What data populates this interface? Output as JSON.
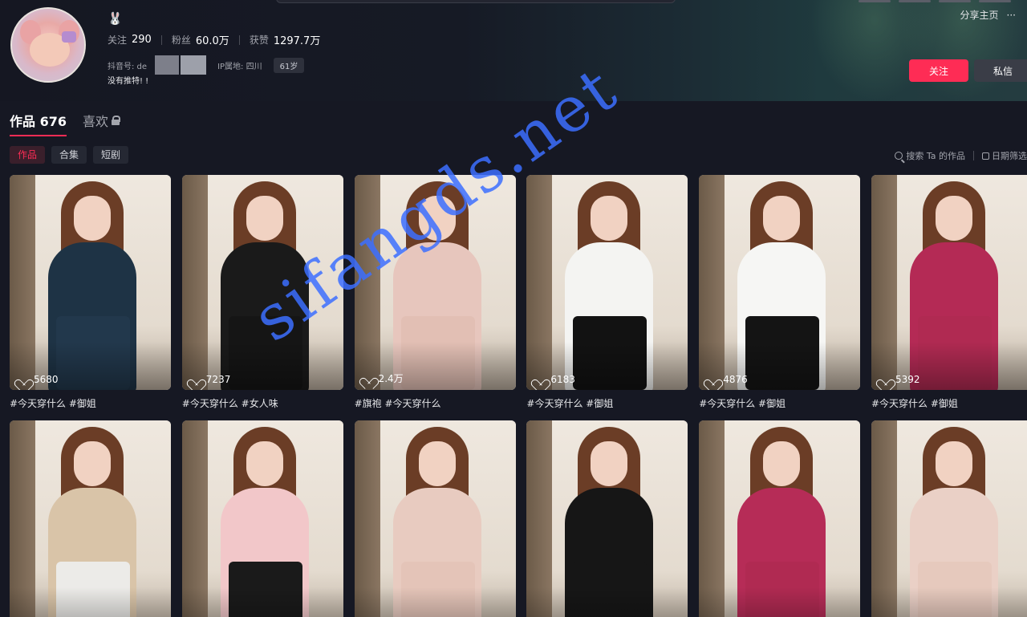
{
  "profile": {
    "name_icon": "rabbit-icon",
    "stats": [
      {
        "label": "关注",
        "value": "290"
      },
      {
        "label": "粉丝",
        "value": "60.0万"
      },
      {
        "label": "获赞",
        "value": "1297.7万"
      }
    ],
    "douyin_id_label": "抖音号: de",
    "ip_label": "IP属地: 四川",
    "age": "61岁",
    "bio": "没有推特! !",
    "share_label": "分享主页",
    "more_label": "···",
    "follow_label": "关注",
    "message_label": "私信"
  },
  "tabs": [
    {
      "label": "作品 676",
      "active": true
    },
    {
      "label": "喜欢",
      "active": false,
      "locked": true
    }
  ],
  "subtabs": [
    {
      "label": "作品",
      "active": true
    },
    {
      "label": "合集",
      "active": false
    },
    {
      "label": "短剧",
      "active": false
    }
  ],
  "tools": {
    "search_label": "搜索 Ta 的作品",
    "date_filter_label": "日期筛选"
  },
  "watermark": "sifangds.net",
  "colors": {
    "accent": "#fe2c55",
    "background": "#161823"
  },
  "videos": [
    {
      "likes": "5680",
      "caption": "#今天穿什么 #御姐",
      "outfit": "#1e3345",
      "skirt": "#22384c"
    },
    {
      "likes": "7237",
      "caption": "#今天穿什么 #女人味",
      "outfit": "#1a1a1a",
      "skirt": "#151515"
    },
    {
      "likes": "2.4万",
      "caption": "#旗袍 #今天穿什么",
      "outfit": "#e7c6bd",
      "skirt": "#e2bfb4"
    },
    {
      "likes": "6183",
      "caption": "#今天穿什么 #御姐",
      "outfit": "#f4f4f2",
      "skirt": "#121212"
    },
    {
      "likes": "4876",
      "caption": "#今天穿什么 #御姐",
      "outfit": "#f6f6f4",
      "skirt": "#141414"
    },
    {
      "likes": "5392",
      "caption": "#今天穿什么 #御姐",
      "outfit": "#b42a55",
      "skirt": "#b02a52"
    },
    {
      "likes": "",
      "caption": "",
      "outfit": "#d9c4a8",
      "skirt": "#ecebe8"
    },
    {
      "likes": "",
      "caption": "",
      "outfit": "#f2c7c9",
      "skirt": "#1a1a1a"
    },
    {
      "likes": "",
      "caption": "",
      "outfit": "#e8cbc0",
      "skirt": "#e4c4b8"
    },
    {
      "likes": "",
      "caption": "",
      "outfit": "#161616",
      "skirt": "#161616"
    },
    {
      "likes": "",
      "caption": "",
      "outfit": "#b62c57",
      "skirt": "#b02a52"
    },
    {
      "likes": "",
      "caption": "",
      "outfit": "#ead0c6",
      "skirt": "#e6c9bd"
    }
  ]
}
